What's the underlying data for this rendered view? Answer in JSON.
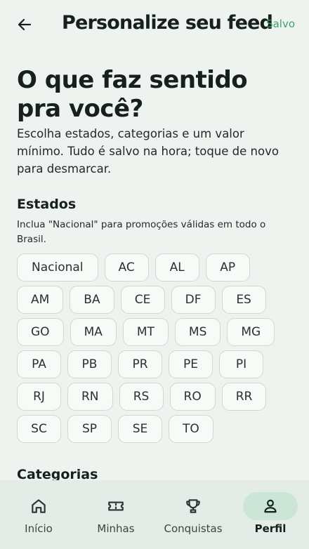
{
  "header": {
    "back_icon": "arrow-left-icon",
    "title": "Personalize seu feed",
    "status": "Salvo"
  },
  "intro": {
    "headline": "O que faz sentido pra você?",
    "description": "Escolha estados, categorias e um valor mínimo. Tudo é salvo na hora; toque de novo para desmarcar."
  },
  "estados": {
    "title": "Estados",
    "hint": "Inclua \"Nacional\" para promoções válidas em todo o Brasil.",
    "options": [
      "Nacional",
      "AC",
      "AL",
      "AP",
      "AM",
      "BA",
      "CE",
      "DF",
      "ES",
      "GO",
      "MA",
      "MT",
      "MS",
      "MG",
      "PA",
      "PB",
      "PR",
      "PE",
      "PI",
      "RJ",
      "RN",
      "RS",
      "RO",
      "RR",
      "SC",
      "SP",
      "SE",
      "TO"
    ]
  },
  "categorias": {
    "title": "Categorias"
  },
  "nav": {
    "items": [
      {
        "label": "Início",
        "icon": "home-icon",
        "active": false
      },
      {
        "label": "Minhas",
        "icon": "ticket-icon",
        "active": false
      },
      {
        "label": "Conquistas",
        "icon": "trophy-icon",
        "active": false
      },
      {
        "label": "Perfil",
        "icon": "person-icon",
        "active": true
      }
    ]
  },
  "colors": {
    "accent": "#3f9e6d",
    "active_pill": "#cbe6d6",
    "background": "#eef3ef"
  }
}
